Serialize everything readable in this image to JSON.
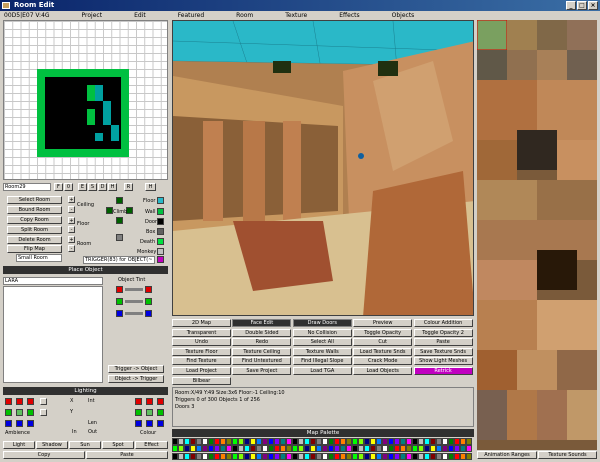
{
  "window": {
    "title": "Room Edit"
  },
  "menu": {
    "coord": "00D5|E07 V:4G",
    "items": [
      "Project",
      "Edit",
      "Featured",
      "Room",
      "Texture",
      "Effects",
      "Objects"
    ]
  },
  "room": {
    "name_value": "Room29",
    "flip_buttons": [
      "F",
      "0",
      "E",
      "S",
      "D",
      "H",
      "R",
      "H"
    ],
    "buttons": [
      "Select Room",
      "Bound Room",
      "Copy Room",
      "Split Room",
      "Delete Room",
      "Flip Map"
    ],
    "size_select": "Small Room",
    "ceiling_label": "Ceiling",
    "floor_label": "Floor",
    "room_label": "Room",
    "climb_label": "Climb",
    "trigger_text": "TRIGGER(83) for OBJECT(~",
    "legend": [
      "Floor",
      "Wall",
      "Door",
      "Box",
      "Death",
      "Monkey"
    ]
  },
  "place_object": {
    "header": "Place Object",
    "search_value": "LARA",
    "tint_label": "Object Tint",
    "trigger_to_object": "Trigger -> Object",
    "object_to_trigger": "Object -> Trigger"
  },
  "lighting": {
    "header": "Lighting",
    "ambience_label": "Ambience",
    "colour_label": "Colour",
    "x_label": "X",
    "y_label": "Y",
    "int_label": "Int",
    "len_label": "Len",
    "out_label": "Out",
    "in_label": "In",
    "buttons": [
      "Light",
      "Shadow",
      "Sun",
      "Spot",
      "Effect",
      "Copy",
      "Paste"
    ]
  },
  "tools": {
    "rows": [
      [
        "2D Map",
        "Face Edit",
        "Draw Doors",
        "Preview",
        "Colour Addition"
      ],
      [
        "Transparent",
        "Double Sided",
        "No Collision",
        "Toggle Opacity",
        "Toggle Opacity 2"
      ],
      [
        "Undo",
        "Redo",
        "Select All",
        "Cut",
        "Paste"
      ],
      [
        "Texture Floor",
        "Texture Ceiling",
        "Texture Walls",
        "Load Texture Snds",
        "Save Texture Snds"
      ],
      [
        "Find Texture",
        "Find Untextured",
        "Find Illegal Slope",
        "Crack Mode",
        "Show Light Meshes"
      ],
      [
        "Load Project",
        "Save Project",
        "Load TGA",
        "Load Objects",
        "Retrick"
      ],
      [
        "Bilbear"
      ]
    ]
  },
  "status": {
    "line1": "Room:X/49 Y:49     Size:3x6     Floor:-1 Ceiling:10",
    "line2": "Triggers 0 of 300   Objects 1 of 256",
    "line3": "Doors 3"
  },
  "palette": {
    "header": "Map Palette"
  },
  "texture_panel": {
    "tabs": [
      "Animation Ranges",
      "Texture Sounds"
    ]
  },
  "colors": {
    "accent_cyan": "#2ab8c8",
    "magenta": "#c000c0",
    "green": "#00c040"
  }
}
